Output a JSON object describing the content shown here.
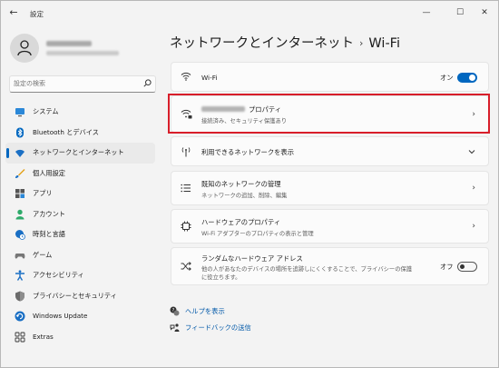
{
  "window": {
    "title": "設定",
    "back_label": "←",
    "controls": {
      "minimize": "—",
      "maximize": "☐",
      "close": "✕"
    }
  },
  "sidebar": {
    "search_placeholder": "設定の検索",
    "items": [
      {
        "label": "システム",
        "icon": "monitor-icon"
      },
      {
        "label": "Bluetooth とデバイス",
        "icon": "bluetooth-icon"
      },
      {
        "label": "ネットワークとインターネット",
        "icon": "wifi-icon",
        "selected": true
      },
      {
        "label": "個人用設定",
        "icon": "brush-icon"
      },
      {
        "label": "アプリ",
        "icon": "apps-icon"
      },
      {
        "label": "アカウント",
        "icon": "person-icon"
      },
      {
        "label": "時刻と言語",
        "icon": "globe-clock-icon"
      },
      {
        "label": "ゲーム",
        "icon": "gamepad-icon"
      },
      {
        "label": "アクセシビリティ",
        "icon": "accessibility-icon"
      },
      {
        "label": "プライバシーとセキュリティ",
        "icon": "shield-icon"
      },
      {
        "label": "Windows Update",
        "icon": "windows-update-icon"
      },
      {
        "label": "Extras",
        "icon": "extras-icon"
      }
    ]
  },
  "header": {
    "parent": "ネットワークとインターネット",
    "separator": "›",
    "current": "Wi-Fi"
  },
  "cards": {
    "wifi": {
      "title": "Wi-Fi",
      "toggle_label": "オン",
      "toggle_on": true
    },
    "properties": {
      "title": "プロパティ",
      "subtitle": "接続済み、セキュリティ保護あり"
    },
    "available": {
      "title": "利用できるネットワークを表示"
    },
    "known": {
      "title": "既知のネットワークの管理",
      "subtitle": "ネットワークの追加、削除、編集"
    },
    "hardware": {
      "title": "ハードウェアのプロパティ",
      "subtitle": "Wi-Fi アダプターのプロパティの表示と管理"
    },
    "random": {
      "title": "ランダムなハードウェア アドレス",
      "subtitle_line1": "他の人があなたのデバイスの場所を追跡しにくくすることで、プライバシーの保護",
      "subtitle_line2": "に役立ちます。",
      "toggle_label": "オフ",
      "toggle_on": false
    }
  },
  "links": {
    "help": "ヘルプを表示",
    "feedback": "フィードバックの送信"
  },
  "colors": {
    "accent": "#0067c0",
    "highlight_border": "#d81e2a"
  }
}
